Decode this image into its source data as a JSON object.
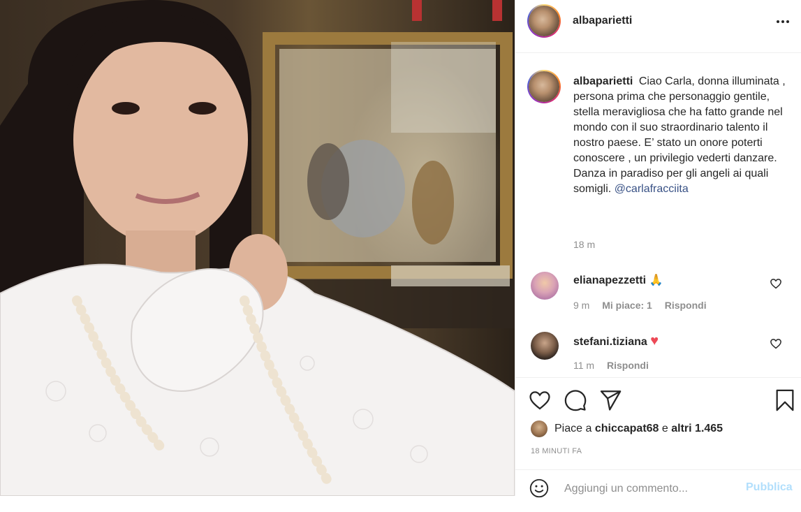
{
  "post": {
    "username": "albaparietti",
    "more_icon": "more-horizontal-icon"
  },
  "caption": {
    "username": "albaparietti",
    "text": "Ciao Carla, donna illuminata , persona prima che personaggio gentile, stella meravigliosa che ha fatto grande nel mondo con il suo straordinario talento il nostro paese. E’ stato un onore poterti conoscere , un privilegio vederti danzare. Danza in paradiso per gli angeli ai quali somigli.",
    "mention": "@carlafracciita",
    "time": "18 m"
  },
  "comments": [
    {
      "username": "elianapezzetti",
      "emoji": "🙏",
      "time": "9 m",
      "likes": "Mi piace: 1",
      "reply": "Rispondi"
    },
    {
      "username": "stefani.tiziana",
      "emoji": "♥",
      "time": "11 m",
      "reply": "Rispondi"
    }
  ],
  "likes": {
    "prefix": "Piace a",
    "user": "chiccapat68",
    "middle": "e",
    "others": "altri 1.465"
  },
  "timestamp": "18 MINUTI FA",
  "add_comment": {
    "placeholder": "Aggiungi un commento...",
    "publish": "Pubblica"
  },
  "colors": {
    "text": "#262626",
    "secondary": "#8e8e8e",
    "mention": "#385185",
    "publish_disabled": "#b2dffc",
    "heart": "#ed4956"
  },
  "icons": [
    "heart-icon",
    "comment-icon",
    "share-icon",
    "bookmark-icon",
    "emoji-icon"
  ]
}
